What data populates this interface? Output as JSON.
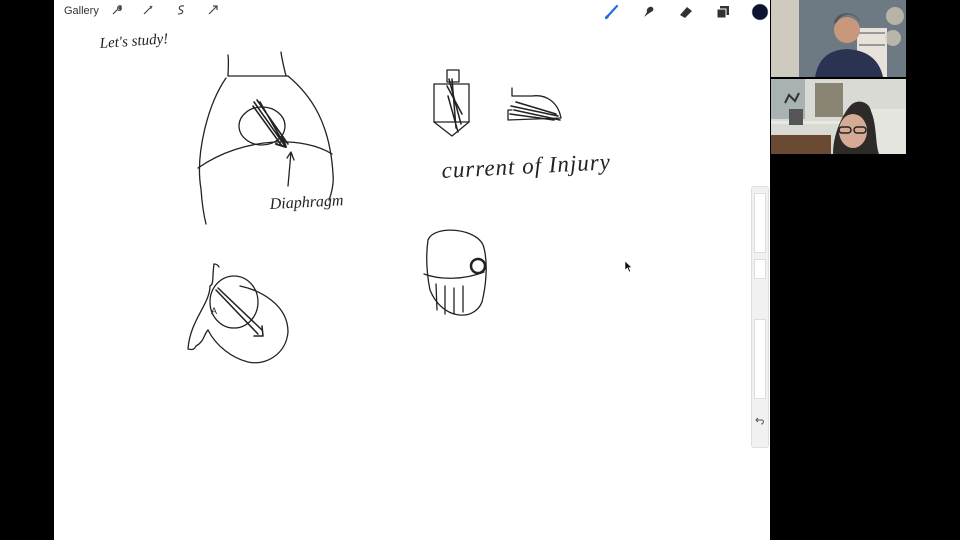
{
  "toolbar": {
    "gallery_label": "Gallery",
    "action_icons": [
      "wrench-icon",
      "magic-wand-icon",
      "selection-icon",
      "transform-icon"
    ],
    "tools": [
      "brush-icon",
      "smudge-icon",
      "eraser-icon",
      "layers-icon",
      "color-swatch"
    ],
    "active_tool_color": "#1e6fd9",
    "current_color": "#0d1433"
  },
  "canvas": {
    "heading": "Let's study!",
    "annotations": {
      "diaphragm": "Diaphragm",
      "current_of_injury": "current of Injury",
      "label_a": "A"
    }
  },
  "side_slider": {
    "undo_icon": "undo-icon"
  },
  "participants": [
    "participant-video-1",
    "participant-video-2"
  ]
}
